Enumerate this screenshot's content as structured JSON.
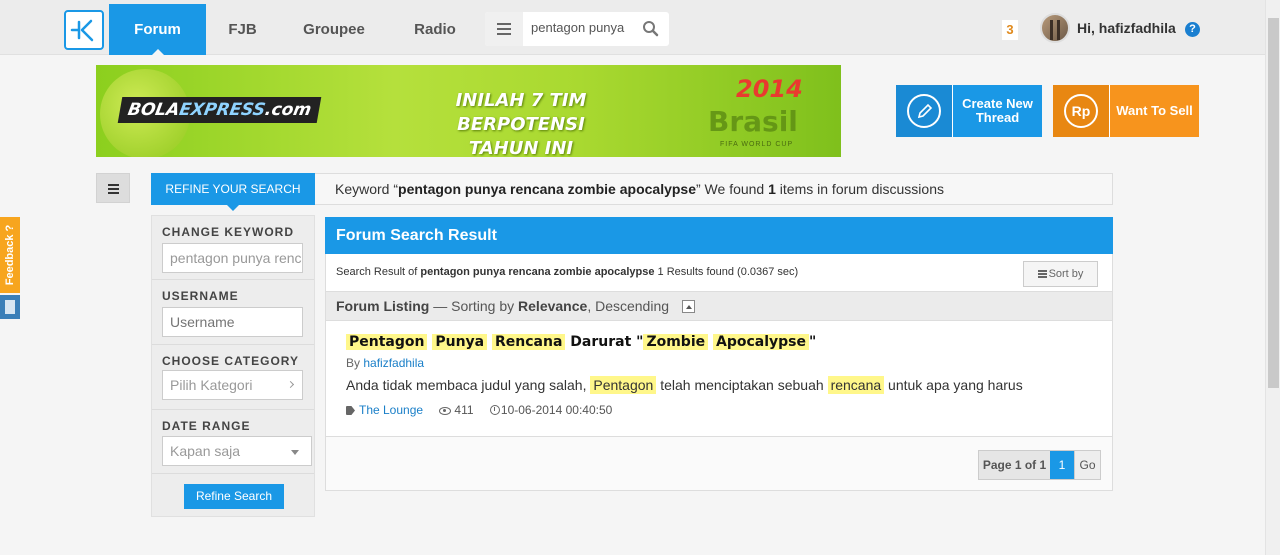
{
  "nav": {
    "items": [
      {
        "label": "Forum",
        "active": true
      },
      {
        "label": "FJB",
        "active": false
      },
      {
        "label": "Groupee",
        "active": false
      },
      {
        "label": "Radio",
        "active": false
      }
    ],
    "search": {
      "value": "pentagon punya"
    },
    "notif_count": "3",
    "greeting": "Hi, hafizfadhila",
    "help": "?"
  },
  "banner": {
    "brand_a": "BOLA",
    "brand_b": "EXPRESS",
    "brand_c": ".com",
    "line1": "INILAH 7 TIM BERPOTENSI",
    "line2": "TAHUN INI",
    "year": "2014",
    "country": "Brasil",
    "tagline": "FIFA WORLD CUP"
  },
  "actions": {
    "create_line1": "Create New",
    "create_line2": "Thread",
    "sell": "Want To Sell",
    "sell_icon": "Rp"
  },
  "refine": {
    "tab": "REFINE YOUR SEARCH",
    "keyword_prefix": "Keyword “",
    "keyword": "pentagon punya rencana zombie apocalypse",
    "keyword_mid": "” We found ",
    "count": "1",
    "keyword_suffix": " items in forum discussions"
  },
  "filters": {
    "keyword_label": "CHANGE KEYWORD",
    "keyword_value": "pentagon punya rencana zombie apocalypse",
    "username_label": "USERNAME",
    "username_placeholder": "Username",
    "category_label": "CHOOSE CATEGORY",
    "category_value": "Pilih Kategori",
    "date_label": "DATE RANGE",
    "date_value": "Kapan saja",
    "submit": "Refine Search"
  },
  "results": {
    "title": "Forum Search Result",
    "meta_prefix": "Search Result of ",
    "meta_query": "pentagon punya rencana zombie apocalypse",
    "meta_suffix": " 1 Results found (0.0367 sec)",
    "sort_label": "Sort by",
    "listing_a": "Forum Listing",
    "listing_b": " — Sorting by ",
    "listing_c": "Relevance",
    "listing_d": ", Descending",
    "item": {
      "t1": "Pentagon",
      "t2": "Punya",
      "t3": "Rencana",
      "t4": " Darurat \"",
      "t5": "Zombie",
      "t6": "Apocalypse",
      "t7": "\"",
      "by_prefix": "By ",
      "author": "hafizfadhila",
      "s1": "Anda tidak membaca judul yang salah, ",
      "s2": "Pentagon",
      "s3": " telah menciptakan sebuah ",
      "s4": "rencana",
      "s5": " untuk apa yang harus",
      "category": "The Lounge",
      "views": "411",
      "date": "10-06-2014 00:40:50"
    },
    "pager_info": "Page 1 of 1",
    "pager_page": "1",
    "pager_go": "Go"
  },
  "feedback": "Feedback ?"
}
